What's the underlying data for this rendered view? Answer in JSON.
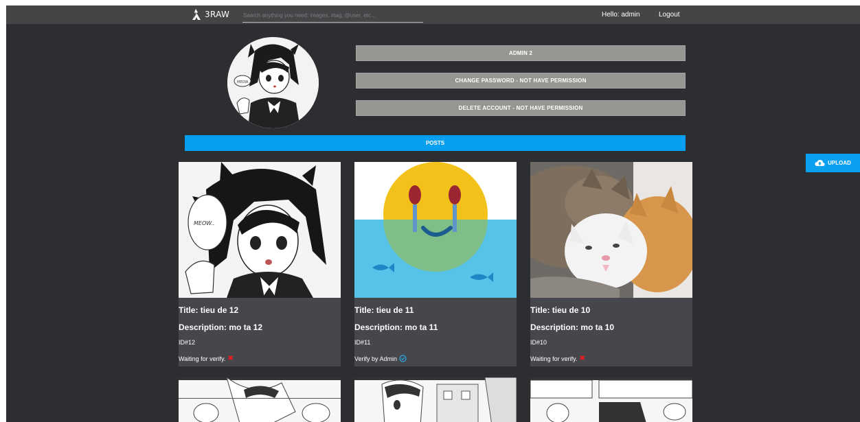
{
  "app": {
    "name": "3RAW"
  },
  "search": {
    "placeholder": "Search anything you need: images, #tag, @user, etc..."
  },
  "header": {
    "hello": "Hello: admin",
    "logout": "Logout"
  },
  "profile": {
    "username_button": "ADMIN 2",
    "change_password_button": "CHANGE PASSWORD - NOT HAVE PERMISSION",
    "delete_account_button": "DELETE ACCOUNT - NOT HAVE PERMISSION"
  },
  "posts_label": "POSTS",
  "upload_label": "UPLOAD",
  "avatar_caption": "MEOW..",
  "posts": [
    {
      "title": "Title: tieu de 12",
      "description": "Description: mo ta 12",
      "id": "ID#12",
      "status": "Waiting for verify.",
      "verified": false,
      "image_caption": "MEOW.."
    },
    {
      "title": "Title: tieu de 11",
      "description": "Description: mo ta 11",
      "id": "ID#11",
      "status": "Verify by Admin",
      "verified": true
    },
    {
      "title": "Title: tieu de 10",
      "description": "Description: mo ta 10",
      "id": "ID#10",
      "status": "Waiting for verify.",
      "verified": false
    }
  ],
  "colors": {
    "accent": "#099ff0",
    "background": "#2d2e31",
    "topbar": "#454548",
    "profile_button": "#979591",
    "card": "#46474d",
    "unverified": "#e02020",
    "verified": "#29a8e8"
  },
  "icons": {
    "logo": "raw-logo-icon",
    "upload": "cloud-upload-icon",
    "verified": "check-circle-icon",
    "unverified": "x-mark-icon"
  }
}
